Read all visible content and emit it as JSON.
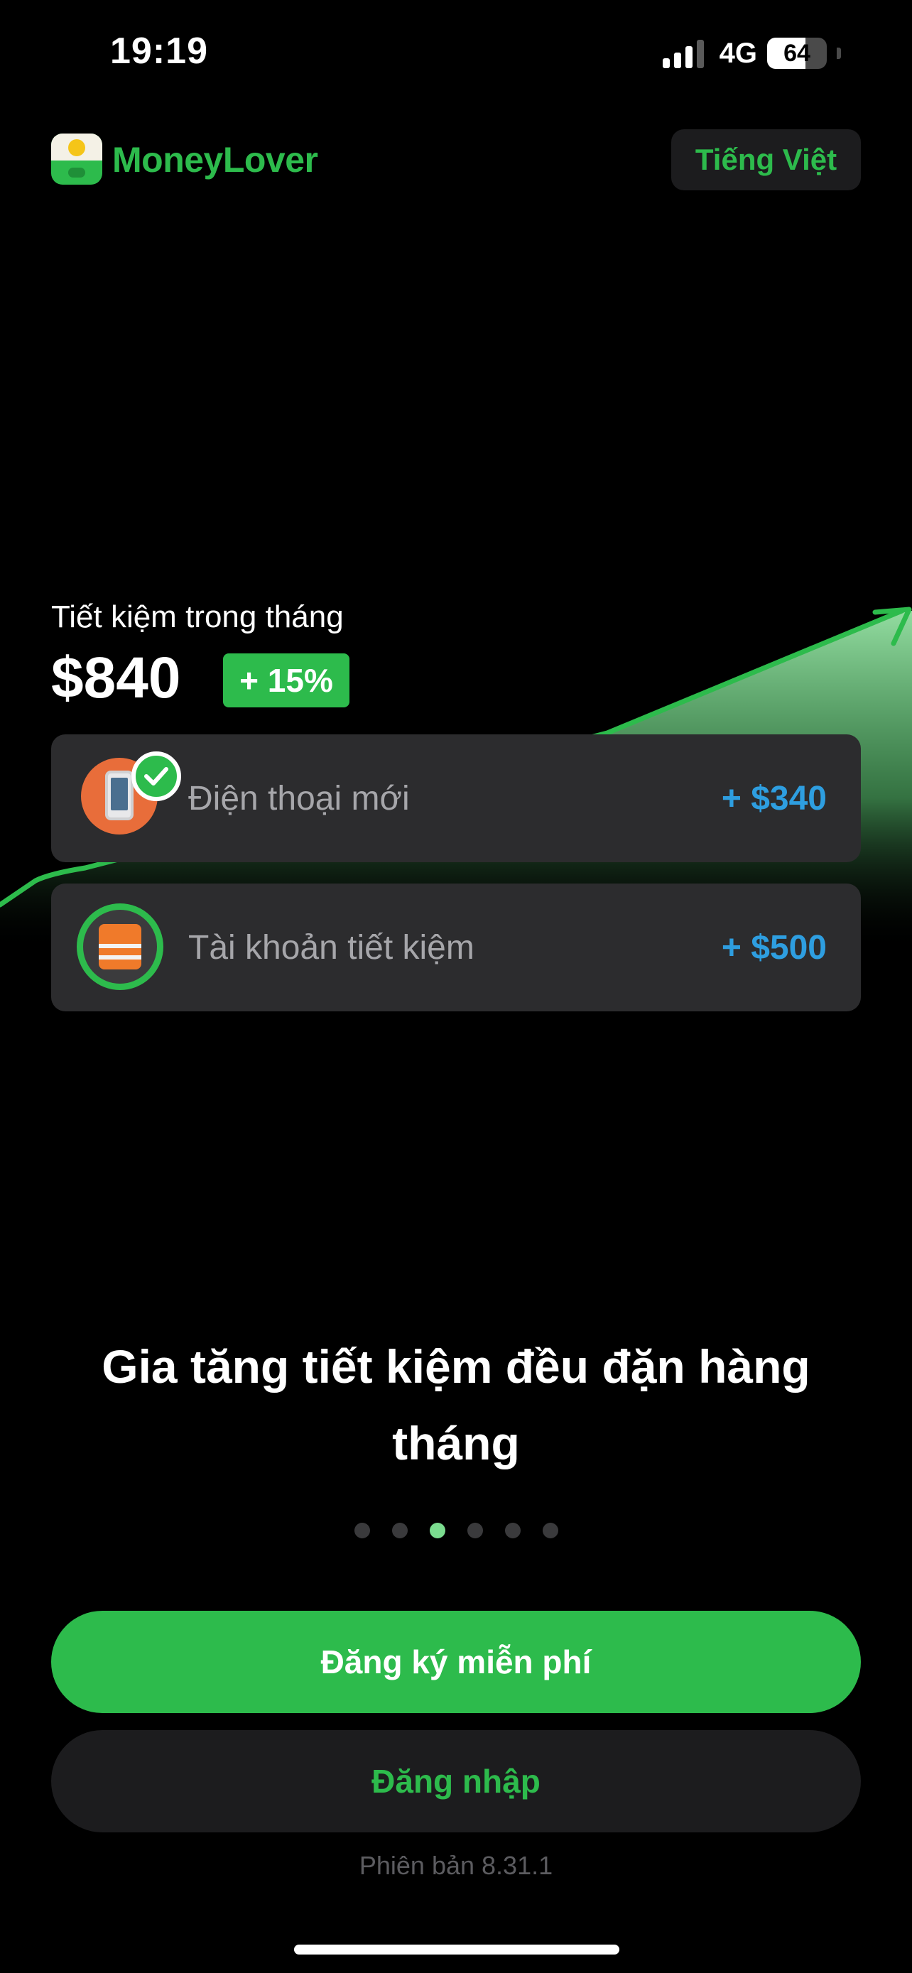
{
  "status_bar": {
    "time": "19:19",
    "network": "4G",
    "battery_level": "64",
    "battery_fraction": 0.64
  },
  "header": {
    "app_name": "MoneyLover",
    "language_label": "Tiếng Việt",
    "logo_icon": "piggy-bank-icon"
  },
  "illustration": {
    "saving_label": "Tiết kiệm trong tháng",
    "saving_amount": "$840",
    "saving_change": "+ 15%",
    "items": [
      {
        "name": "Điện thoại mới",
        "amount": "+ $340",
        "icon": "phone-icon",
        "status_icon": "check-icon"
      },
      {
        "name": "Tài khoản tiết kiệm",
        "amount": "+ $500",
        "icon": "life-vest-icon"
      }
    ],
    "accent_color": "#2dbb4c",
    "amount_color": "#2e9ee0"
  },
  "onboarding": {
    "headline": "Gia tăng tiết kiệm đều đặn hàng tháng",
    "page_count": 6,
    "current_page": 3
  },
  "actions": {
    "signup_label": "Đăng ký miễn phí",
    "login_label": "Đăng nhập"
  },
  "footer": {
    "version": "Phiên bản 8.31.1"
  }
}
